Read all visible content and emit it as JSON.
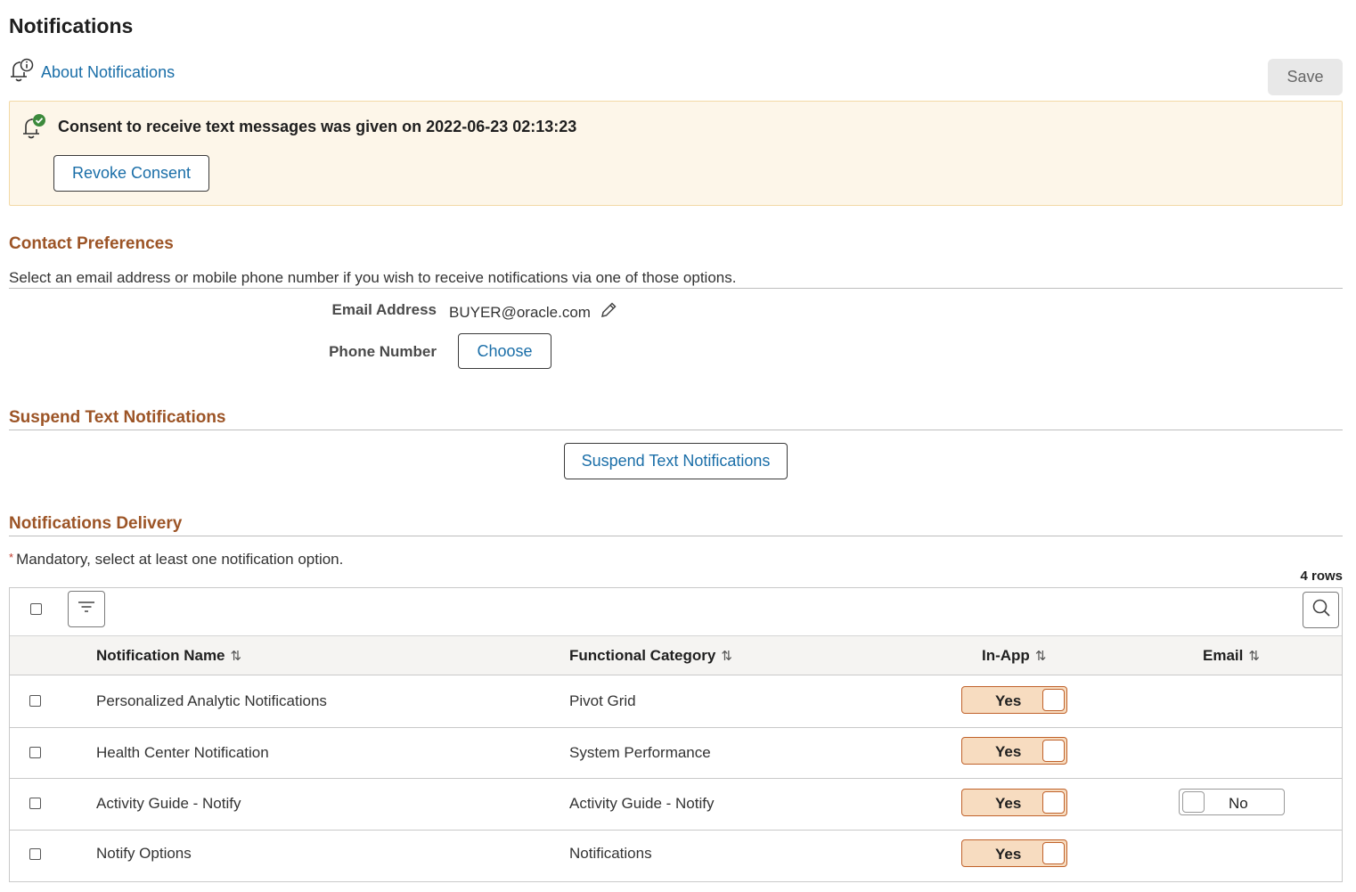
{
  "page": {
    "title": "Notifications"
  },
  "about": {
    "label": "About Notifications",
    "icon": "bell-info-icon"
  },
  "toolbar": {
    "save_label": "Save"
  },
  "consent": {
    "message": "Consent to receive text messages was given on 2022-06-23 02:13:23",
    "revoke_label": "Revoke Consent",
    "icon": "bell-check-icon"
  },
  "contact": {
    "title": "Contact Preferences",
    "description": "Select an email address or mobile phone number if you wish to receive notifications via one of those options.",
    "email_label": "Email Address",
    "email_value": "BUYER@oracle.com",
    "phone_label": "Phone Number",
    "choose_label": "Choose"
  },
  "suspend": {
    "title": "Suspend Text Notifications",
    "button_label": "Suspend Text Notifications"
  },
  "delivery": {
    "title": "Notifications Delivery",
    "mandatory_star": "*",
    "mandatory_text": "Mandatory, select at least one notification option.",
    "rows_count": "4 rows",
    "columns": [
      "Notification Name",
      "Functional Category",
      "In-App",
      "Email"
    ],
    "rows": [
      {
        "name": "Personalized Analytic Notifications",
        "category": "Pivot Grid",
        "in_app": "Yes",
        "email": ""
      },
      {
        "name": "Health Center Notification",
        "category": "System Performance",
        "in_app": "Yes",
        "email": ""
      },
      {
        "name": "Activity Guide - Notify",
        "category": "Activity Guide - Notify",
        "in_app": "Yes",
        "email": "No"
      },
      {
        "name": "Notify Options",
        "category": "Notifications",
        "in_app": "Yes",
        "email": ""
      }
    ]
  },
  "colors": {
    "link": "#1a6ea8",
    "section_title": "#9c5426",
    "consent_bg": "#fdf6e9",
    "toggle_on_bg": "#f7dcc0",
    "toggle_on_border": "#c0622b",
    "consent_check": "#3c8a3c"
  }
}
